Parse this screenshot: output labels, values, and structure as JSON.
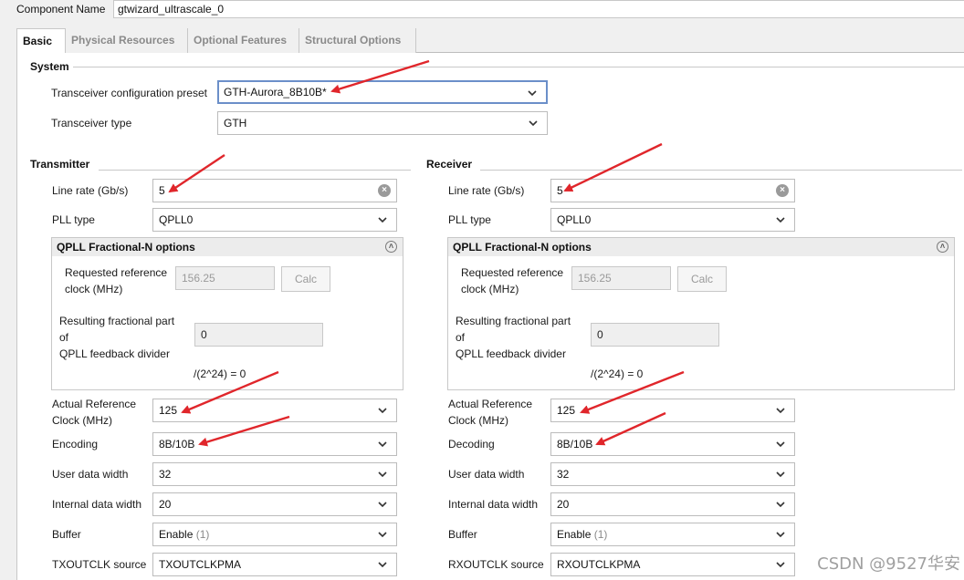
{
  "component": {
    "label": "Component Name",
    "value": "gtwizard_ultrascale_0"
  },
  "tabs": [
    "Basic",
    "Physical Resources",
    "Optional Features",
    "Structural Options"
  ],
  "system": {
    "title": "System",
    "preset_label": "Transceiver configuration preset",
    "preset_value": "GTH-Aurora_8B10B*",
    "type_label": "Transceiver type",
    "type_value": "GTH"
  },
  "tx": {
    "title": "Transmitter",
    "line_rate_label": "Line rate (Gb/s)",
    "line_rate": "5",
    "pll_label": "PLL type",
    "pll": "QPLL0",
    "frac_title": "QPLL Fractional-N options",
    "req_ref_label_1": "Requested reference",
    "req_ref_label_2": "clock (MHz)",
    "req_ref": "156.25",
    "calc": "Calc",
    "result_label_1": "Resulting fractional part",
    "result_label_2": "of",
    "result_label_3": "QPLL feedback divider",
    "result_value": "0",
    "result_formula": "/(2^24) = 0",
    "act_ref_label_1": "Actual Reference",
    "act_ref_label_2": "Clock (MHz)",
    "act_ref": "125",
    "encoding_label": "Encoding",
    "encoding": "8B/10B",
    "user_width_label": "User data width",
    "user_width": "32",
    "internal_width_label": "Internal data width",
    "internal_width": "20",
    "buffer_label": "Buffer",
    "buffer": "Enable",
    "buffer_suffix": "(1)",
    "outclk_label": "TXOUTCLK source",
    "outclk": "TXOUTCLKPMA"
  },
  "rx": {
    "title": "Receiver",
    "line_rate_label": "Line rate (Gb/s)",
    "line_rate": "5",
    "pll_label": "PLL type",
    "pll": "QPLL0",
    "frac_title": "QPLL Fractional-N options",
    "req_ref_label_1": "Requested reference",
    "req_ref_label_2": "clock (MHz)",
    "req_ref": "156.25",
    "calc": "Calc",
    "result_label_1": "Resulting fractional part",
    "result_label_2": "of",
    "result_label_3": "QPLL feedback divider",
    "result_value": "0",
    "result_formula": "/(2^24) = 0",
    "act_ref_label_1": "Actual Reference",
    "act_ref_label_2": "Clock (MHz)",
    "act_ref": "125",
    "encoding_label": "Decoding",
    "encoding": "8B/10B",
    "user_width_label": "User data width",
    "user_width": "32",
    "internal_width_label": "Internal data width",
    "internal_width": "20",
    "buffer_label": "Buffer",
    "buffer": "Enable",
    "buffer_suffix": "(1)",
    "outclk_label": "RXOUTCLK source",
    "outclk": "RXOUTCLKPMA"
  },
  "watermark": "CSDN @9527华安",
  "colors": {
    "annotation_arrow": "#e0262b",
    "focus_border": "#6b8fc9"
  }
}
